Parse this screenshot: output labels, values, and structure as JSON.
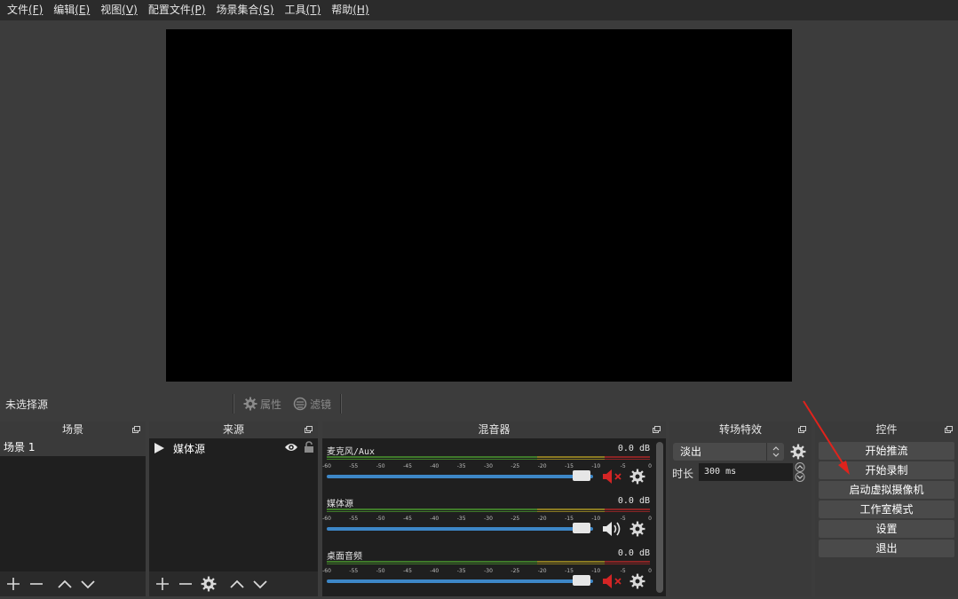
{
  "menu": [
    {
      "label": "文件",
      "key": "(F)"
    },
    {
      "label": "编辑",
      "key": "(E)"
    },
    {
      "label": "视图",
      "key": "(V)"
    },
    {
      "label": "配置文件",
      "key": "(P)"
    },
    {
      "label": "场景集合",
      "key": "(S)"
    },
    {
      "label": "工具",
      "key": "(T)"
    },
    {
      "label": "帮助",
      "key": "(H)"
    }
  ],
  "source_toolbar": {
    "no_source": "未选择源",
    "properties": "属性",
    "filters": "滤镜"
  },
  "scenes": {
    "title": "场景",
    "items": [
      "场景 1"
    ]
  },
  "sources": {
    "title": "来源",
    "items": [
      "媒体源"
    ]
  },
  "mixer": {
    "title": "混音器",
    "ticks": [
      "-60",
      "-55",
      "-50",
      "-45",
      "-40",
      "-35",
      "-30",
      "-25",
      "-20",
      "-15",
      "-10",
      "-5",
      "0"
    ],
    "channels": [
      {
        "name": "麦克风/Aux",
        "db": "0.0 dB",
        "muted": true
      },
      {
        "name": "媒体源",
        "db": "0.0 dB",
        "muted": false
      },
      {
        "name": "桌面音频",
        "db": "0.0 dB",
        "muted": true
      }
    ]
  },
  "transitions": {
    "title": "转场特效",
    "selected": "淡出",
    "duration_label": "时长",
    "duration_value": "300 ms"
  },
  "controls": {
    "title": "控件",
    "buttons": [
      "开始推流",
      "开始录制",
      "启动虚拟摄像机",
      "工作室模式",
      "设置",
      "退出"
    ]
  },
  "colors": {
    "background": "#3c3c3c",
    "panel": "#2a2a2a",
    "list_bg": "#1f1f1f",
    "accent_blue": "#3d87c7",
    "mute_red": "#d42525",
    "annotation_red": "#e0231c"
  }
}
